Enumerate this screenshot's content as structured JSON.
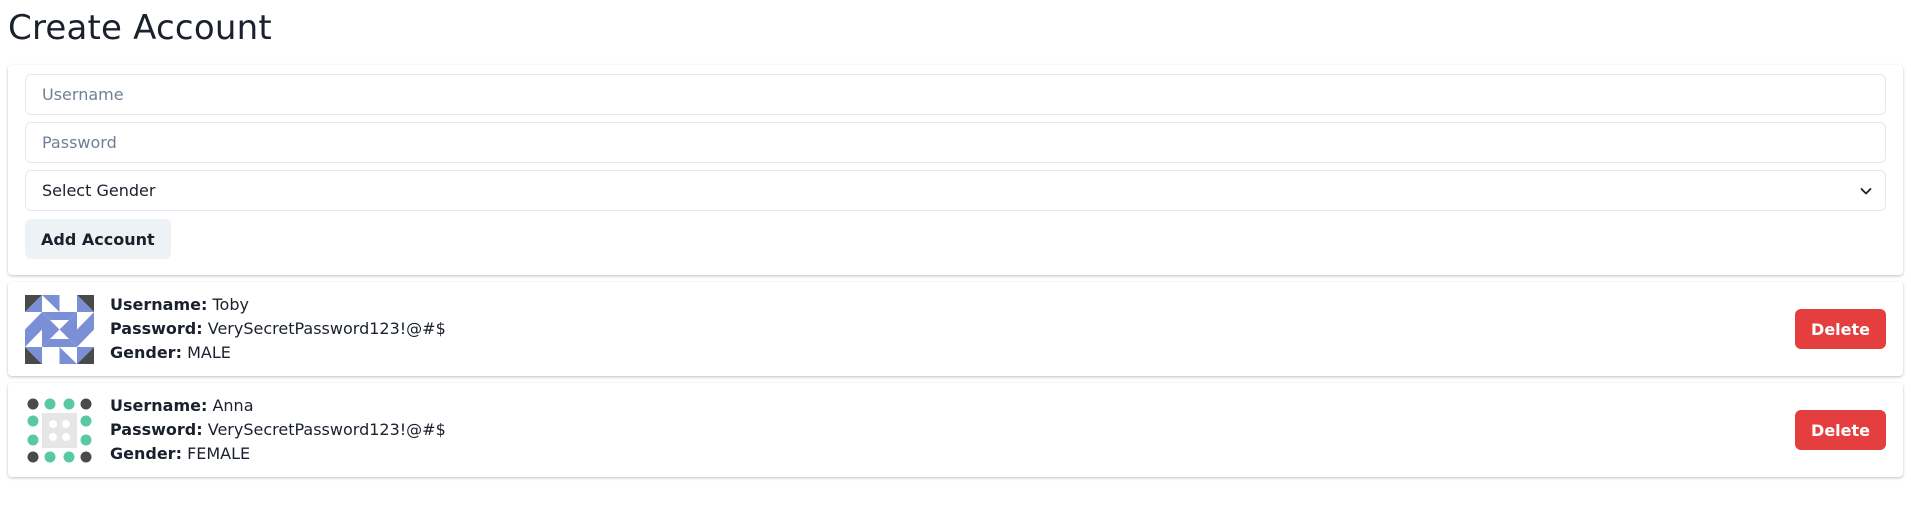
{
  "page": {
    "title": "Create Account"
  },
  "form": {
    "username_placeholder": "Username",
    "password_placeholder": "Password",
    "gender_select_value": "Select Gender",
    "add_button_label": "Add Account"
  },
  "labels": {
    "username": "Username:",
    "password": "Password:",
    "gender": "Gender:"
  },
  "accounts": [
    {
      "username": "Toby",
      "password": "VerySecretPassword123!@#$",
      "gender": "MALE",
      "avatar_icon": "identicon-blue-pinwheel-icon",
      "delete_label": "Delete"
    },
    {
      "username": "Anna",
      "password": "VerySecretPassword123!@#$",
      "gender": "FEMALE",
      "avatar_icon": "identicon-green-dots-icon",
      "delete_label": "Delete"
    }
  ],
  "colors": {
    "delete_button": "#e53e3e",
    "add_button": "#edf2f7",
    "avatar_blue": "#7b8fd6",
    "avatar_dark": "#4a4a4a",
    "avatar_green": "#5ac9a1"
  }
}
